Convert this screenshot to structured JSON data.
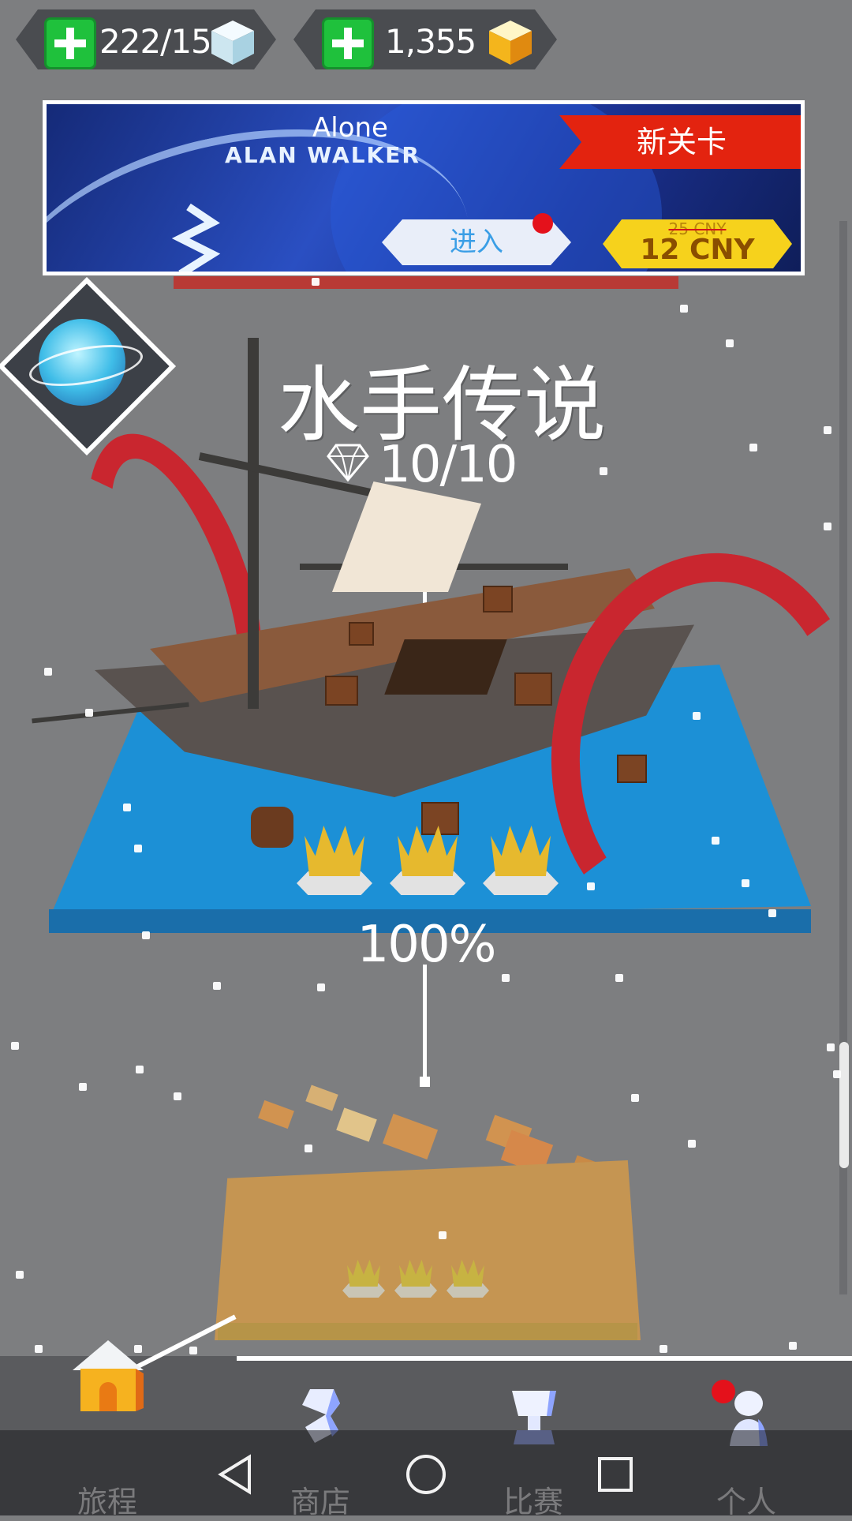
{
  "resources": {
    "cubes": "222/15",
    "gems": "1,355",
    "icons": [
      "plus-icon",
      "white-cube-icon",
      "gold-cube-icon"
    ]
  },
  "banner": {
    "song_title": "Alone",
    "artist": "ALAN WALKER",
    "tag": "新关卡",
    "enter_label": "进入",
    "price_old": "25 CNY",
    "price_new": "12 CNY"
  },
  "level": {
    "title": "水手传说",
    "gems": "10/10",
    "progress": "100%",
    "crowns_earned": 3,
    "crowns_total": 3
  },
  "nav": {
    "items": [
      {
        "label": "旅程",
        "icon": "house-icon"
      },
      {
        "label": "商店",
        "icon": "shop-icon"
      },
      {
        "label": "比赛",
        "icon": "trophy-icon"
      },
      {
        "label": "个人",
        "icon": "profile-icon"
      }
    ]
  },
  "system_nav": [
    "back-icon",
    "home-circle-icon",
    "recents-icon"
  ],
  "colors": {
    "accent_green": "#1fc13c",
    "tag_red": "#e3230f",
    "price_yellow": "#f6d21c",
    "sea_blue": "#1c90d6",
    "background": "#7d7e80"
  }
}
